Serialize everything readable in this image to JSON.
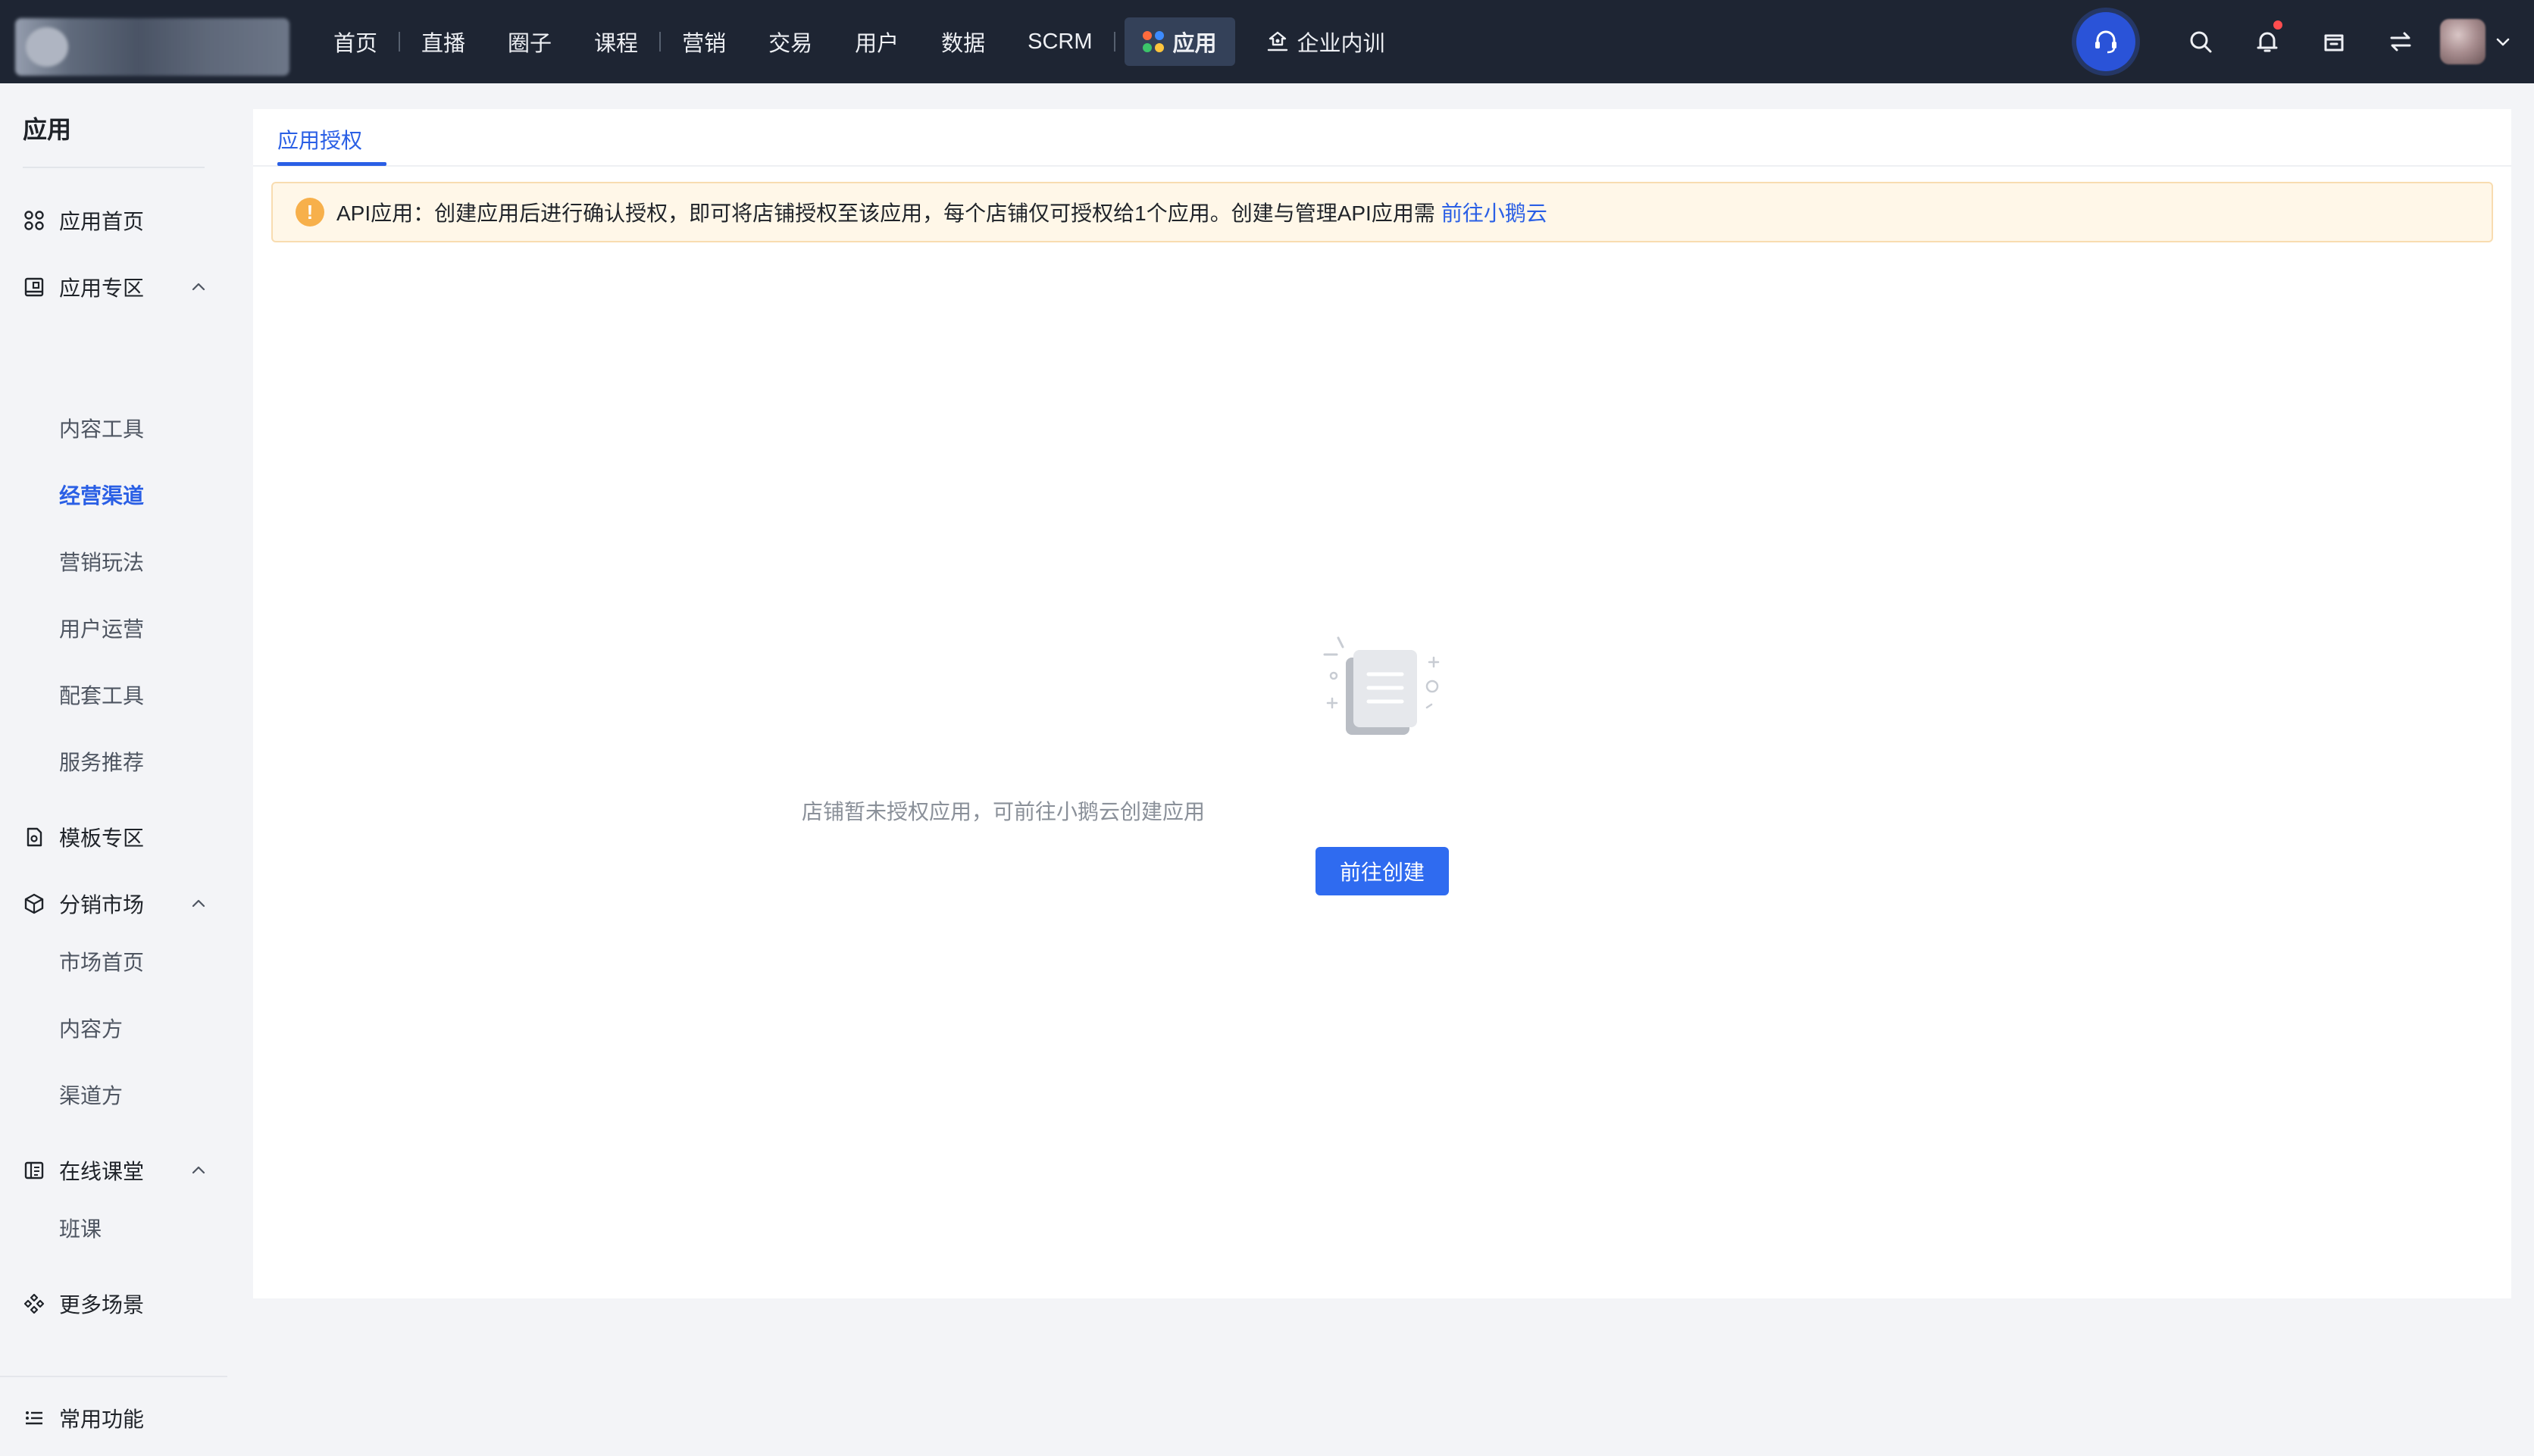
{
  "topbar": {
    "nav": [
      {
        "label": "首页"
      },
      {
        "label": "直播"
      },
      {
        "label": "圈子"
      },
      {
        "label": "课程"
      },
      {
        "label": "营销"
      },
      {
        "label": "交易"
      },
      {
        "label": "用户"
      },
      {
        "label": "数据"
      },
      {
        "label": "SCRM"
      },
      {
        "label": "应用",
        "active": true
      },
      {
        "label": "企业内训"
      }
    ],
    "icons": [
      "customer-service-icon",
      "search-icon",
      "bell-icon",
      "store-icon",
      "switch-icon",
      "avatar",
      "chevron-down-icon"
    ],
    "colors": {
      "bg": "#1e2533",
      "active_bg": "#344159",
      "accent": "#2a53d8"
    }
  },
  "sidebar": {
    "title": "应用",
    "groups": [
      {
        "label": "应用首页",
        "icon": "grid-icon"
      },
      {
        "label": "应用专区",
        "icon": "app-zone-icon",
        "expanded": true,
        "children": [
          "内容工具",
          "经营渠道",
          "营销玩法",
          "用户运营",
          "配套工具",
          "服务推荐"
        ],
        "active_child": "经营渠道"
      },
      {
        "label": "模板专区",
        "icon": "template-icon"
      },
      {
        "label": "分销市场",
        "icon": "distribution-icon",
        "expanded": true,
        "children": [
          "市场首页",
          "内容方",
          "渠道方"
        ]
      },
      {
        "label": "在线课堂",
        "icon": "classroom-icon",
        "expanded": true,
        "children": [
          "班课"
        ]
      },
      {
        "label": "更多场景",
        "icon": "more-scenes-icon"
      }
    ],
    "footer": {
      "label": "常用功能",
      "icon": "list-icon"
    }
  },
  "main": {
    "tab": "应用授权",
    "notice": {
      "text": "API应用：创建应用后进行确认授权，即可将店铺授权至该应用，每个店铺仅可授权给1个应用。创建与管理API应用需",
      "link": "前往小鹅云"
    },
    "empty": {
      "text": "店铺暂未授权应用，可前往小鹅云创建应用",
      "button": "前往创建"
    },
    "colors": {
      "link": "#2a5fe5",
      "button": "#2f6bf0",
      "notice_bg": "#fff7e8",
      "warn": "#f7b04b"
    }
  }
}
